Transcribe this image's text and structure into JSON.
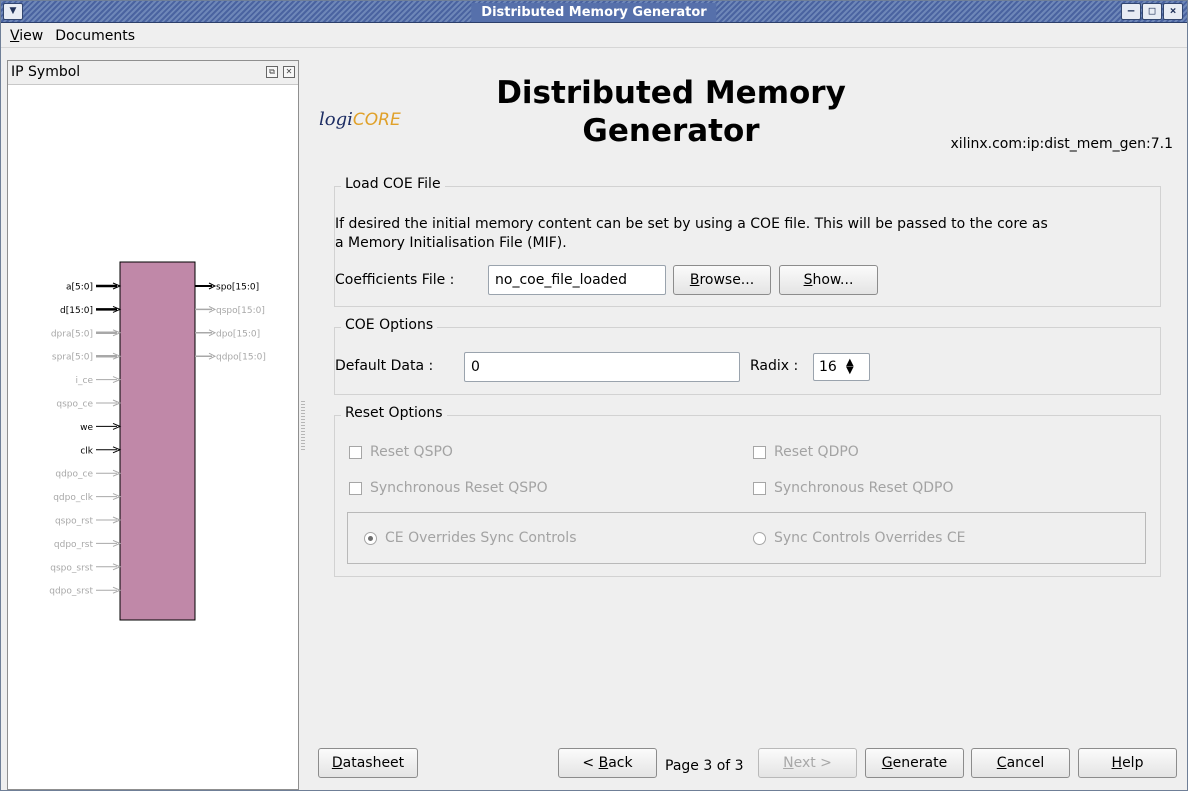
{
  "window": {
    "title": "Distributed Memory Generator"
  },
  "menu": {
    "items": [
      {
        "prefix": "",
        "mnemonic": "V",
        "rest": "iew"
      },
      {
        "prefix": "",
        "mnemonic": "",
        "rest": "Documents"
      }
    ]
  },
  "ip_symbol": {
    "title": "IP Symbol",
    "inputs": [
      {
        "name": "a[5:0]",
        "active": true,
        "bus": true
      },
      {
        "name": "d[15:0]",
        "active": true,
        "bus": true
      },
      {
        "name": "dpra[5:0]",
        "active": false,
        "bus": true
      },
      {
        "name": "spra[5:0]",
        "active": false,
        "bus": true
      },
      {
        "name": "i_ce",
        "active": false,
        "bus": false
      },
      {
        "name": "qspo_ce",
        "active": false,
        "bus": false
      },
      {
        "name": "we",
        "active": true,
        "bus": false
      },
      {
        "name": "clk",
        "active": true,
        "bus": false
      },
      {
        "name": "qdpo_ce",
        "active": false,
        "bus": false
      },
      {
        "name": "qdpo_clk",
        "active": false,
        "bus": false
      },
      {
        "name": "qspo_rst",
        "active": false,
        "bus": false
      },
      {
        "name": "qdpo_rst",
        "active": false,
        "bus": false
      },
      {
        "name": "qspo_srst",
        "active": false,
        "bus": false
      },
      {
        "name": "qdpo_srst",
        "active": false,
        "bus": false
      }
    ],
    "outputs": [
      {
        "name": "spo[15:0]",
        "active": true
      },
      {
        "name": "qspo[15:0]",
        "active": false
      },
      {
        "name": "dpo[15:0]",
        "active": false
      },
      {
        "name": "qdpo[15:0]",
        "active": false
      }
    ],
    "colors": {
      "block": "#c088a8",
      "active": "#000000",
      "inactive": "#a8a8a8"
    }
  },
  "header": {
    "logo_prefix": "logi",
    "logo_suffix": "CORE",
    "title_line1": "Distributed Memory",
    "title_line2": "Generator",
    "vlnv": "xilinx.com:ip:dist_mem_gen:7.1"
  },
  "load_coe": {
    "legend": "Load COE File",
    "description_line1": "If desired the initial memory content can be set by using a COE file.  This will be passed to the core as",
    "description_line2": "a Memory Initialisation File (MIF).",
    "coef_label": "Coefficients File :",
    "coef_value": "no_coe_file_loaded",
    "browse": {
      "mnemonic": "B",
      "rest": "rowse..."
    },
    "show": {
      "mnemonic": "S",
      "rest": "how..."
    }
  },
  "coe_options": {
    "legend": "COE Options",
    "default_label": "Default Data :",
    "default_value": "0",
    "radix_label": "Radix :",
    "radix_value": "16"
  },
  "reset_options": {
    "legend": "Reset Options",
    "reset_qspo": "Reset QSPO",
    "reset_qdpo": "Reset QDPO",
    "sync_reset_qspo": "Synchronous Reset QSPO",
    "sync_reset_qdpo": "Synchronous Reset QDPO",
    "ce_overrides": "CE Overrides Sync Controls",
    "sync_overrides": "Sync Controls Overrides CE"
  },
  "footer": {
    "datasheet": {
      "mnemonic": "D",
      "rest": "atasheet"
    },
    "back": {
      "prefix": "< ",
      "mnemonic": "B",
      "rest": "ack"
    },
    "page": "Page 3 of 3",
    "next": {
      "prefix": "",
      "mnemonic": "N",
      "rest": "ext >"
    },
    "generate": {
      "prefix": "",
      "mnemonic": "G",
      "rest": "enerate"
    },
    "cancel": {
      "prefix": "",
      "mnemonic": "C",
      "rest": "ancel"
    },
    "help": {
      "prefix": "",
      "mnemonic": "H",
      "rest": "elp"
    }
  }
}
